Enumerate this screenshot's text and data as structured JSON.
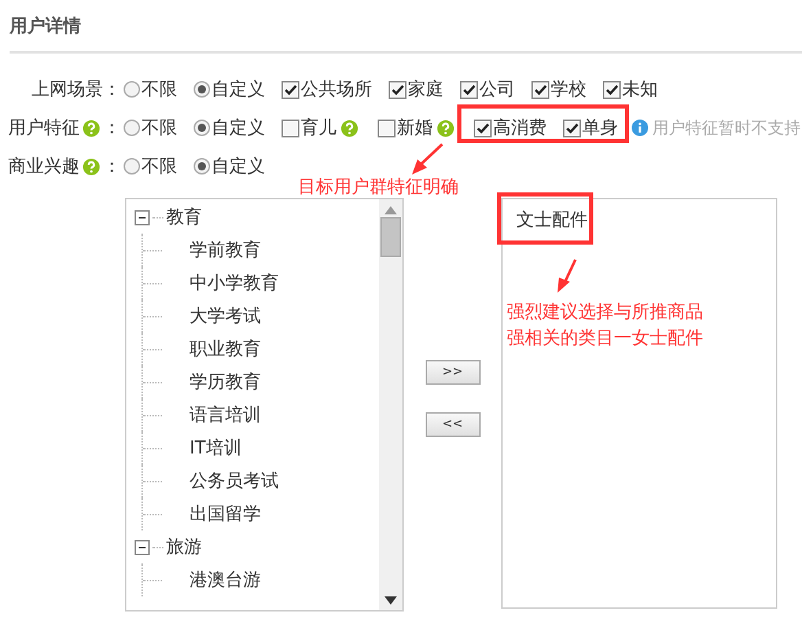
{
  "section_title": "用户详情",
  "fields": [
    {
      "label": "上网场景",
      "help": false,
      "separator": "：",
      "options": [
        {
          "kind": "radio",
          "label": "不限",
          "selected": false,
          "help": false
        },
        {
          "kind": "radio",
          "label": "自定义",
          "selected": true,
          "help": false
        },
        {
          "kind": "checkbox",
          "label": "公共场所",
          "checked": true,
          "help": false
        },
        {
          "kind": "checkbox",
          "label": "家庭",
          "checked": true,
          "help": false
        },
        {
          "kind": "checkbox",
          "label": "公司",
          "checked": true,
          "help": false
        },
        {
          "kind": "checkbox",
          "label": "学校",
          "checked": true,
          "help": false
        },
        {
          "kind": "checkbox",
          "label": "未知",
          "checked": true,
          "help": false
        }
      ]
    },
    {
      "label": "用户特征",
      "help": true,
      "separator": "：",
      "options": [
        {
          "kind": "radio",
          "label": "不限",
          "selected": false,
          "help": false
        },
        {
          "kind": "radio",
          "label": "自定义",
          "selected": true,
          "help": false
        },
        {
          "kind": "checkbox",
          "label": "育儿",
          "checked": false,
          "help": true
        },
        {
          "kind": "checkbox",
          "label": "新婚",
          "checked": false,
          "help": true
        },
        {
          "kind": "checkbox",
          "label": "高消费",
          "checked": true,
          "help": false
        },
        {
          "kind": "checkbox",
          "label": "单身",
          "checked": true,
          "help": false
        }
      ],
      "hint": "用户特征暂时不支持"
    },
    {
      "label": "商业兴趣",
      "help": true,
      "separator": "：",
      "options": [
        {
          "kind": "radio",
          "label": "不限",
          "selected": false,
          "help": false
        },
        {
          "kind": "radio",
          "label": "自定义",
          "selected": true,
          "help": false
        }
      ]
    }
  ],
  "tree": [
    {
      "label": "教育",
      "expanded": true,
      "children": [
        {
          "label": "学前教育"
        },
        {
          "label": "中小学教育"
        },
        {
          "label": "大学考试"
        },
        {
          "label": "职业教育"
        },
        {
          "label": "学历教育"
        },
        {
          "label": "语言培训"
        },
        {
          "label": "IT培训"
        },
        {
          "label": "公务员考试"
        },
        {
          "label": "出国留学"
        }
      ]
    },
    {
      "label": "旅游",
      "expanded": true,
      "children": [
        {
          "label": "港澳台游"
        }
      ]
    }
  ],
  "transfer_buttons": [
    ">>",
    "<<"
  ],
  "selected_items": [
    "文士配件"
  ],
  "annotations": {
    "features_note": "目标用户群特征明确",
    "category_note": [
      "强烈建议选择与所推商品",
      "强相关的类目一女士配件"
    ]
  }
}
